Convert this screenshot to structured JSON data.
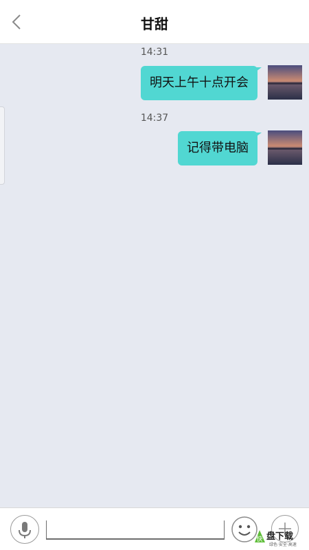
{
  "header": {
    "title": "甘甜",
    "back_icon": "chevron-left-icon"
  },
  "colors": {
    "bubble": "#51d7d2",
    "chat_background": "#e6e9f1",
    "header_background": "#ffffff",
    "watermark_green": "#5fbe3a"
  },
  "messages": [
    {
      "time": "14:31",
      "text": "明天上午十点开会",
      "sender": "self"
    },
    {
      "time": "14:37",
      "text": "记得带电脑",
      "sender": "self"
    }
  ],
  "input_bar": {
    "voice_icon": "microphone-icon",
    "text_value": "",
    "emoji_icon": "smiley-icon",
    "more_icon": "plus-circle-icon"
  },
  "watermark": {
    "logo": "快",
    "name": "盘下载",
    "tagline": "绿色·安全·高速"
  }
}
